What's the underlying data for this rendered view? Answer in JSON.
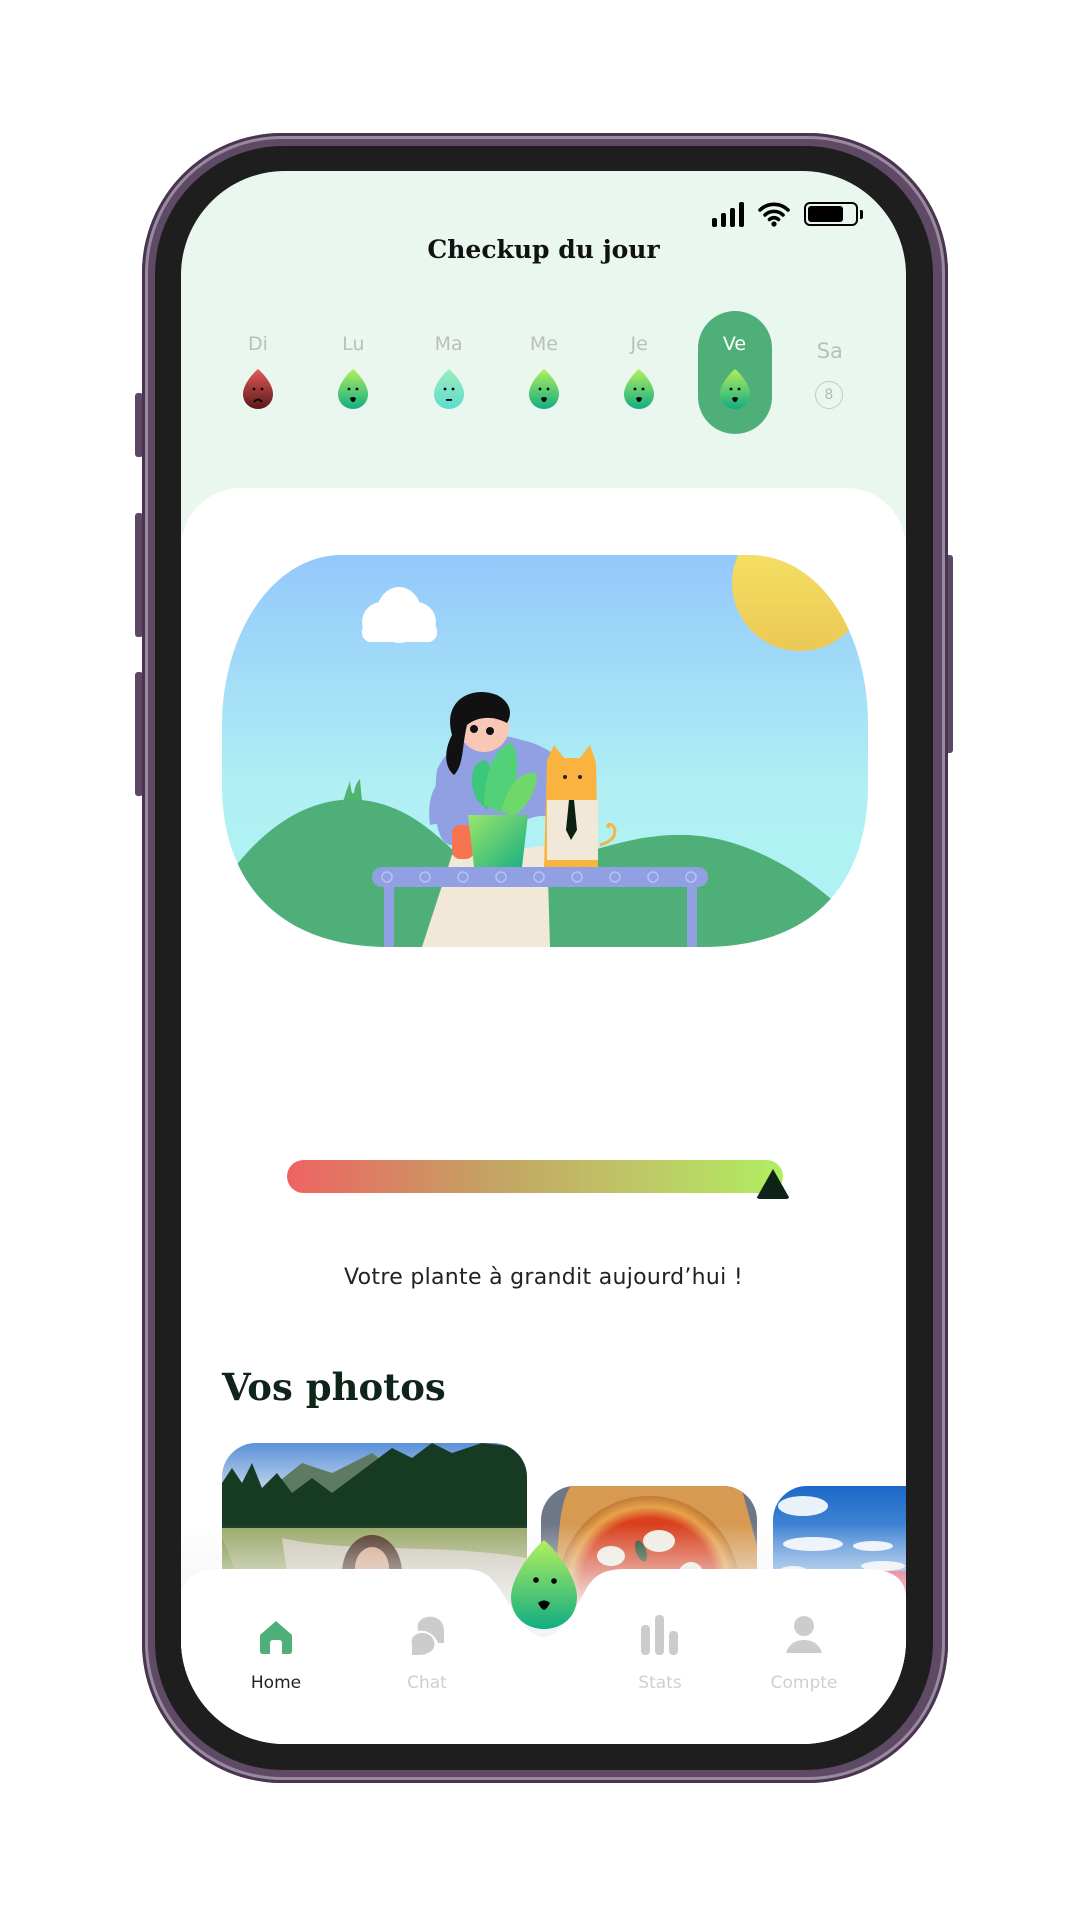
{
  "status_bar": {
    "signal_bars": 4,
    "wifi": true,
    "battery_percent": 75
  },
  "header": {
    "title": "Checkup du jour"
  },
  "days": [
    {
      "label": "Di",
      "mood": "sad",
      "color_top": "#e25a5a",
      "color_bottom": "#5a1818",
      "state": "past"
    },
    {
      "label": "Lu",
      "mood": "happy",
      "color_top": "#b2ef5c",
      "color_bottom": "#12ad82",
      "state": "past"
    },
    {
      "label": "Ma",
      "mood": "neutral",
      "color_top": "#9bedbd",
      "color_bottom": "#5fdcce",
      "state": "past"
    },
    {
      "label": "Me",
      "mood": "happy",
      "color_top": "#b2ef5c",
      "color_bottom": "#12ad82",
      "state": "past"
    },
    {
      "label": "Je",
      "mood": "happy",
      "color_top": "#b2ef5c",
      "color_bottom": "#12ad82",
      "state": "past"
    },
    {
      "label": "Ve",
      "mood": "happy",
      "color_top": "#b2ef5c",
      "color_bottom": "#12ad82",
      "state": "today"
    },
    {
      "label": "Sa",
      "date": "8",
      "state": "future"
    }
  ],
  "growth": {
    "level_fraction": 0.98,
    "message": "Votre plante à grandit aujourd’hui !",
    "colors": {
      "low": "#ee6363",
      "mid": "#c4a263",
      "high": "#b0ee60"
    }
  },
  "photos": {
    "title": "Vos photos",
    "items": [
      {
        "subject": "person-crouching-in-mountain-meadow"
      },
      {
        "subject": "margherita-pizza-on-wooden-board"
      },
      {
        "subject": "red-drink-glass-on-terrace"
      }
    ]
  },
  "nav": {
    "items": [
      {
        "label": "Home",
        "icon": "home-icon",
        "active": true
      },
      {
        "label": "Chat",
        "icon": "chat-icon",
        "active": false
      },
      {
        "label": "Stats",
        "icon": "stats-icon",
        "active": false
      },
      {
        "label": "Compte",
        "icon": "account-icon",
        "active": false
      }
    ],
    "center_button": "plant-mood-button"
  },
  "colors": {
    "accent": "#4faf78",
    "header_bg": "#eaf7ef",
    "inactive": "#cccccc",
    "frame": "#5f4a66"
  }
}
